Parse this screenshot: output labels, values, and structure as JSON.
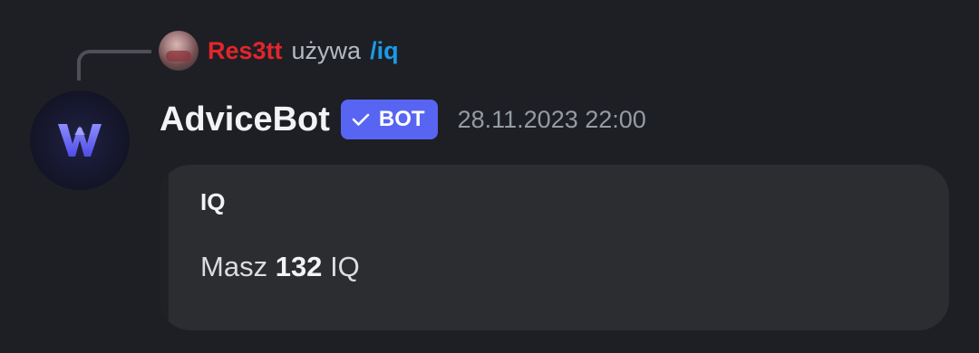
{
  "reply": {
    "username": "Res3tt",
    "verb": "używa",
    "command": "/iq"
  },
  "message": {
    "author": "AdviceBot",
    "tag": "BOT",
    "timestamp": "28.11.2023 22:00"
  },
  "embed": {
    "title": "IQ",
    "text_before": "Masz",
    "value": "132",
    "text_after": "IQ"
  },
  "colors": {
    "background": "#1e1f24",
    "username": "#e2262b",
    "command": "#1a9bea",
    "bot_tag": "#5865f2",
    "embed_bg": "#2b2d31"
  },
  "icons": {
    "reply_avatar": "user-avatar-icon",
    "bot_avatar": "advicebot-logo-icon",
    "verified": "checkmark-icon"
  }
}
